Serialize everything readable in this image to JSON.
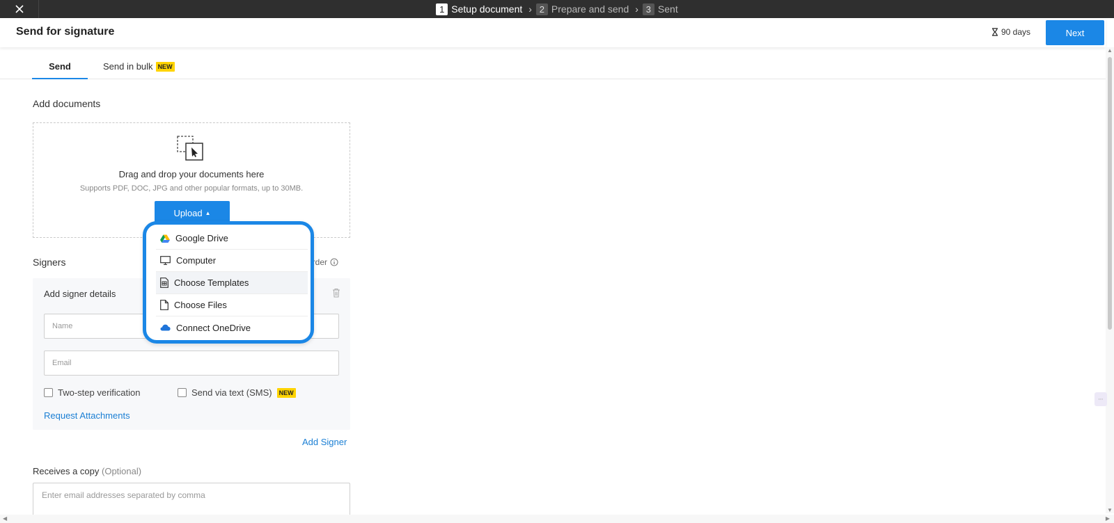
{
  "stepper": {
    "steps": [
      {
        "num": "1",
        "label": "Setup document"
      },
      {
        "num": "2",
        "label": "Prepare and send"
      },
      {
        "num": "3",
        "label": "Sent"
      }
    ]
  },
  "header": {
    "title": "Send for signature",
    "expiry": "90 days",
    "next_label": "Next"
  },
  "tabs": {
    "send": "Send",
    "bulk": "Send in bulk",
    "bulk_badge": "NEW"
  },
  "documents": {
    "label": "Add documents",
    "drop_title": "Drag and drop your documents here",
    "drop_sub": "Supports PDF, DOC, JPG and other popular formats, up to 30MB.",
    "upload_label": "Upload"
  },
  "upload_menu": {
    "items": [
      {
        "label": "Google Drive",
        "icon": "google-drive-icon"
      },
      {
        "label": "Computer",
        "icon": "monitor-icon"
      },
      {
        "label": "Choose Templates",
        "icon": "template-icon"
      },
      {
        "label": "Choose Files",
        "icon": "file-icon"
      },
      {
        "label": "Connect OneDrive",
        "icon": "onedrive-icon"
      }
    ]
  },
  "signers": {
    "label": "Signers",
    "order_label": "order",
    "card_title": "Add signer details",
    "name_placeholder": "Name",
    "email_placeholder": "Email",
    "two_step": "Two-step verification",
    "sms": "Send via text (SMS)",
    "sms_badge": "NEW",
    "request_attachments": "Request Attachments",
    "add_signer": "Add Signer"
  },
  "copy": {
    "label": "Receives a copy",
    "optional": "(Optional)",
    "placeholder": "Enter email addresses separated by comma"
  },
  "colors": {
    "accent": "#1b87e6",
    "topbar": "#2f2f2f",
    "badge": "#ffd400",
    "link": "#1b7fd4"
  }
}
